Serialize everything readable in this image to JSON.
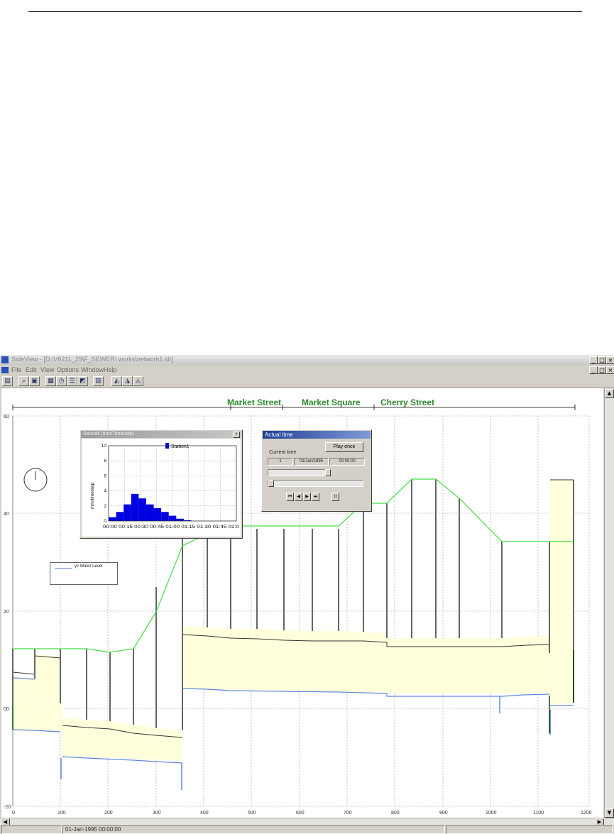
{
  "window": {
    "title": "SideView - [D:\\V6211_29\\F_SEWER\\ works\\network1.idr]"
  },
  "menu": [
    "File",
    "Edit",
    "View",
    "Options",
    "Window",
    "Help"
  ],
  "toolbar_icons": [
    "print-icon",
    "zoom-icon",
    "fit-icon",
    "grid-icon",
    "clock-icon",
    "list-icon",
    "export-icon",
    "chart-icon",
    "pipe-1-icon",
    "pipe-2-icon",
    "pipe-3-icon"
  ],
  "streets": [
    "Market Street",
    "Market Square",
    "Cherry Street"
  ],
  "y_axis": {
    "ticks": [
      "-20",
      "00",
      "20",
      "40",
      "60"
    ]
  },
  "x_axis": {
    "ticks": [
      "0",
      "100",
      "200",
      "300",
      "400",
      "500",
      "600",
      "700",
      "800",
      "900",
      "1000",
      "1100",
      "1200"
    ]
  },
  "legend": {
    "label": "ys Water Level"
  },
  "rainfall": {
    "title": "Rainfall (mm/Timestep)",
    "series_name": "Station1",
    "ylabel": "mm/timestep",
    "y_ticks": [
      "10",
      "8",
      "6",
      "4",
      "2",
      "0"
    ],
    "x_labels": "00:00 00:15 00:30 00:45 01:00 01:15 01:30 01:45 02:0",
    "color": "#0000e0",
    "chart_data": {
      "type": "bar",
      "series": [
        {
          "name": "Station1",
          "values": [
            0.5,
            1.2,
            2.2,
            3.6,
            3.0,
            2.2,
            1.7,
            1.2,
            0.7,
            0.3,
            0.1,
            0.0,
            0.0,
            0.0,
            0.0,
            0.0,
            0.0
          ]
        }
      ],
      "ylim": [
        0,
        10
      ]
    }
  },
  "actual_time": {
    "title": "Actual time",
    "current_time_label": "Current time",
    "play_button": "Play once",
    "step": "1",
    "date": "01/Jan/1995",
    "time": "00:00:00",
    "controls": [
      "⏮",
      "◀",
      "▶",
      "⏭"
    ],
    "pause": "II"
  },
  "status": {
    "left": "",
    "time": "01-Jan-1995 00:00:00"
  },
  "colors": {
    "ground_line": "#44dd44",
    "water_fill": "#ffffdc",
    "invert_line": "#5f87e0",
    "street_text": "#2d8b2d"
  }
}
